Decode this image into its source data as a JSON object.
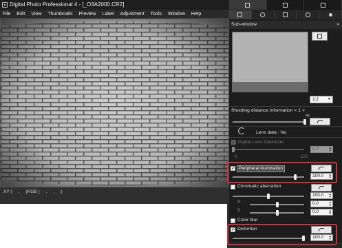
{
  "window": {
    "title": "Digital Photo Professional 4 - [_O3A2000.CR2]",
    "menu": [
      "File",
      "Edit",
      "View",
      "Thumbnails",
      "Preview",
      "Label",
      "Adjustment",
      "Tools",
      "Window",
      "Help"
    ]
  },
  "statusbar": {
    "coords": "XY (     ,     )RGB (     ,     ,     )"
  },
  "palette": {
    "subwindow_label": "Sub-window",
    "zoom_value": "1:2",
    "shooting_distance_label": "Shooting distance information  < 1 >",
    "infinity_symbol": "∞",
    "lens_data_label": "Lens data : No",
    "digital_lens_optimizer_label": "Digital Lens Optimizer",
    "dlo_value": "0.0",
    "dlo_min": "0",
    "dlo_max": "100",
    "peripheral_label": "Peripheral illumination",
    "peripheral_value": "100.0",
    "chromatic_label": "Chromatic aberration",
    "chroma_r_label": "R",
    "chroma_b_label": "B",
    "chroma_values": [
      "100.0",
      "0.0",
      "0.0"
    ],
    "color_blur_label": "Color blur",
    "distortion_label": "Distortion",
    "distortion_value": "100.0"
  },
  "colors": {
    "highlight": "#d0303c",
    "panel_bg": "#1d1d1d"
  }
}
